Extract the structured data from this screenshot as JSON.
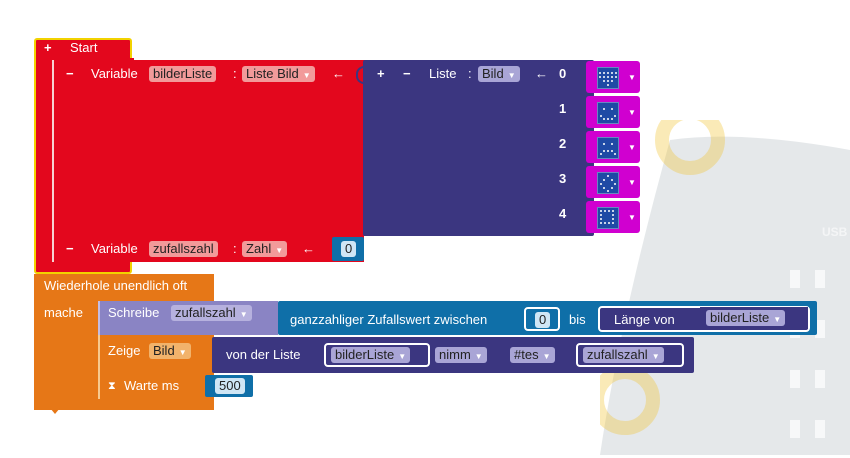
{
  "colors": {
    "start": "#e3071d",
    "list": "#3b3680",
    "loop": "#e67717",
    "write": "#8a84c4",
    "image": "#d000d0",
    "number_field": "#0f6fa8",
    "board": "#2c3e50"
  },
  "start_block": {
    "plus": "+",
    "label": "Start"
  },
  "var_bilder": {
    "minus": "−",
    "label": "Variable",
    "name": "bilderListe",
    "colon": ":",
    "type": "Liste Bild",
    "assign": "←"
  },
  "list_block": {
    "plus": "+",
    "minus": "−",
    "label": "Liste",
    "colon": ":",
    "type": "Bild",
    "assign": "←",
    "items": [
      {
        "index": "0",
        "image": "heart-icon"
      },
      {
        "index": "1",
        "image": "smile-icon"
      },
      {
        "index": "2",
        "image": "sad-icon"
      },
      {
        "index": "3",
        "image": "diamond-icon"
      },
      {
        "index": "4",
        "image": "square-icon"
      }
    ]
  },
  "var_zufall": {
    "minus": "−",
    "label": "Variable",
    "name": "zufallszahl",
    "colon": ":",
    "type": "Zahl",
    "assign": "←",
    "value": "0"
  },
  "loop": {
    "label": "Wiederhole unendlich oft",
    "do_label": "mache"
  },
  "write_block": {
    "label": "Schreibe",
    "var": "zufallszahl"
  },
  "random_block": {
    "label": "ganzzahliger Zufallswert zwischen",
    "from": "0",
    "to_label": "bis",
    "length_label": "Länge von",
    "list_var": "bilderListe"
  },
  "show_block": {
    "label": "Zeige",
    "type": "Bild",
    "from_list_label": "von der Liste",
    "list_var": "bilderListe",
    "mode": "nimm",
    "position": "#tes",
    "index_var": "zufallszahl"
  },
  "wait_block": {
    "label": "Warte ms",
    "value": "500"
  },
  "board": {
    "label": "USB"
  }
}
